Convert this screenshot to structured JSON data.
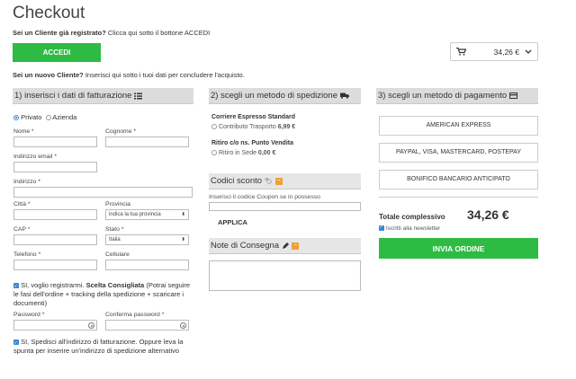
{
  "page": {
    "title": "Checkout"
  },
  "login": {
    "prompt_bold": "Sei un Cliente già registrato?",
    "prompt_text": " Clicca qui sotto il bottone ACCEDI",
    "button": "ACCEDI"
  },
  "cart": {
    "total": "34,26 €",
    "icon": "cart-icon"
  },
  "new_customer": {
    "prompt_bold": "Sei un nuovo Cliente?",
    "prompt_text": " Inserisci qui sotto i tuoi dati per concludere l'acquisto."
  },
  "billing": {
    "header": "1) inserisci i dati di fatturazione",
    "type_private": "Privato",
    "type_company": "Azienda",
    "nome": "Nome *",
    "cognome": "Cognome *",
    "email": "Indirizzo email *",
    "indirizzo": "Indirizzo *",
    "citta": "Città *",
    "provincia": "Provincia",
    "provincia_value": "indica la tua provincia",
    "cap": "CAP *",
    "stato": "Stato *",
    "stato_value": "Italia",
    "telefono": "Telefono *",
    "cellulare": "Cellulare",
    "register_text_a": "SI, voglio registrarmi. ",
    "register_text_b": "Scelta Consigliata",
    "register_text_c": " (Potrai seguire le fasi dell'ordine + tracking della spedizione + scaricare i documenti)",
    "password": "Password *",
    "confirm_password": "Conferma password *",
    "ship_same": "SI, Spedisci all'indirizzo di fatturazione. Oppure leva la spunta per inserire un'indirizzo di spedizione alternativo"
  },
  "shipping": {
    "header": "2) scegli un metodo di spedizione",
    "opt1_title": "Corriere Espresso Standard",
    "opt1_label": "Contributo Trasporto ",
    "opt1_price": "6,99 €",
    "opt2_title": "Ritiro c/o ns. Punto Vendita",
    "opt2_label": "Ritiro in Sede ",
    "opt2_price": "0,00 €",
    "coupon_header": "Codici sconto",
    "coupon_placeholder": "Inserisci il codice Coupon se in possesso",
    "coupon_button": "APPLICA",
    "notes_header": "Note di Consegna",
    "minus": "−"
  },
  "payment": {
    "header": "3) scegli un metodo di pagamento",
    "methods": [
      "AMERICAN EXPRESS",
      "PAYPAL, VISA, MASTERCARD, POSTEPAY",
      "BONIFICO BANCARIO ANTICIPATO"
    ],
    "total_label": "Totale complessivo",
    "total_value": "34,26 €",
    "newsletter": "Iscritti alla newsletter",
    "submit": "INVIA ORDINE"
  }
}
